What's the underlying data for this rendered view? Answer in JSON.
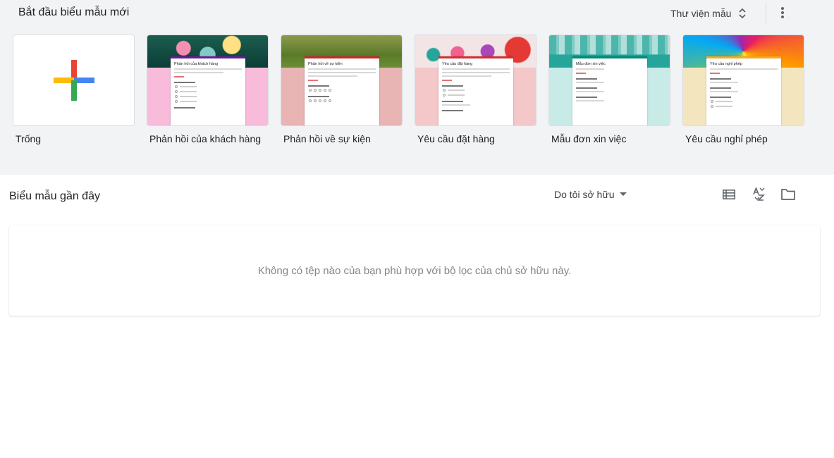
{
  "gallery": {
    "title": "Bắt đầu biểu mẫu mới",
    "library_label": "Thư viện mẫu",
    "templates": [
      {
        "name": "Trống",
        "form_title": ""
      },
      {
        "name": "Phản hồi của khách hàng",
        "form_title": "Phản hồi của khách hàng"
      },
      {
        "name": "Phản hồi về sự kiện",
        "form_title": "Phản hồi về sự kiện"
      },
      {
        "name": "Yêu cầu đặt hàng",
        "form_title": "Yêu cầu đặt hàng"
      },
      {
        "name": "Mẫu đơn xin việc",
        "form_title": "Mẫu đơn xin việc"
      },
      {
        "name": "Yêu cầu nghỉ phép",
        "form_title": "Yêu cầu nghỉ phép"
      }
    ]
  },
  "recent": {
    "title": "Biểu mẫu gần đây",
    "owner_filter": "Do tôi sở hữu",
    "empty_message": "Không có tệp nào của bạn phù hợp với bộ lọc của chủ sở hữu này."
  },
  "colors": {
    "plus_red": "#ea4335",
    "plus_blue": "#4285f4",
    "plus_green": "#34a853",
    "plus_yellow": "#fbbc04"
  }
}
